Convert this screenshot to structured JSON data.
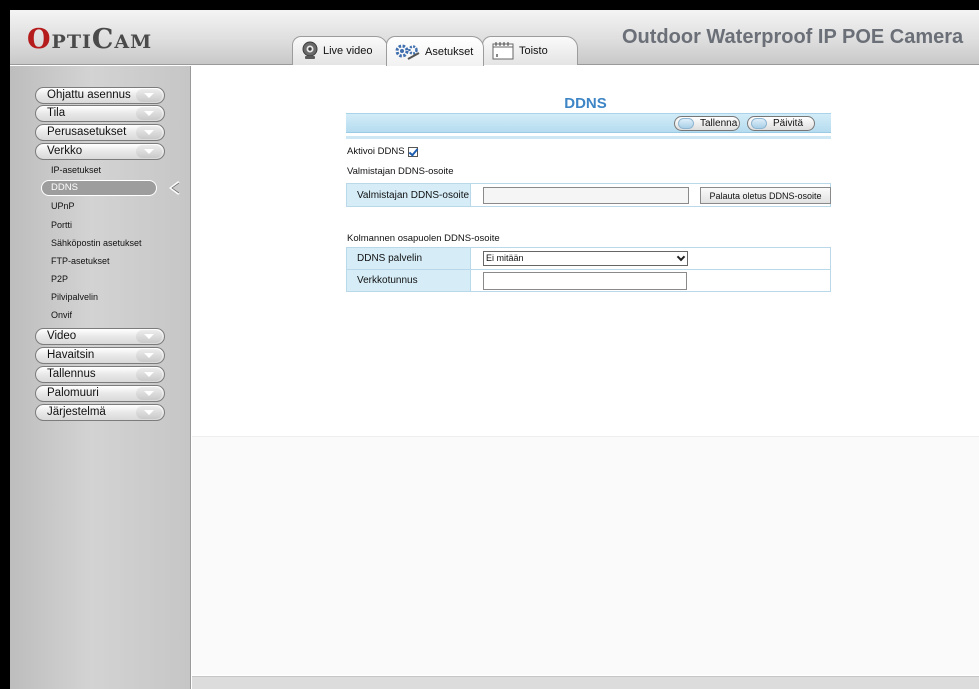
{
  "header": {
    "logo_first": "O",
    "logo_rest_1": "PTI",
    "logo_mid": "C",
    "logo_rest_2": "AM",
    "product_title": "Outdoor Waterproof IP POE Camera",
    "tabs": [
      {
        "label": "Live video",
        "icon": "webcam-icon"
      },
      {
        "label": "Asetukset",
        "icon": "gears-icon"
      },
      {
        "label": "Toisto",
        "icon": "calendar-icon"
      }
    ],
    "active_tab": "Asetukset"
  },
  "sidebar": {
    "menu": [
      {
        "label": "Ohjattu asennus"
      },
      {
        "label": "Tila"
      },
      {
        "label": "Perusasetukset"
      },
      {
        "label": "Verkko"
      }
    ],
    "network_sub": [
      {
        "label": "IP-asetukset"
      },
      {
        "label": "DDNS"
      },
      {
        "label": "UPnP"
      },
      {
        "label": "Portti"
      },
      {
        "label": "Sähköpostin asetukset"
      },
      {
        "label": "FTP-asetukset"
      },
      {
        "label": "P2P"
      },
      {
        "label": "Pilvipalvelin"
      },
      {
        "label": "Onvif"
      }
    ],
    "menu_after": [
      {
        "label": "Video"
      },
      {
        "label": "Havaitsin"
      },
      {
        "label": "Tallennus"
      },
      {
        "label": "Palomuuri"
      },
      {
        "label": "Järjestelmä"
      }
    ],
    "selected": "DDNS"
  },
  "main": {
    "title": "DDNS",
    "save_label": "Tallenna",
    "refresh_label": "Päivitä",
    "enable_label": "Aktivoi DDNS",
    "enable_checked": true,
    "manufacturer_section": "Valmistajan DDNS-osoite",
    "manufacturer_field_label": "Valmistajan DDNS-osoite",
    "manufacturer_field_value": "",
    "restore_button_label": "Palauta oletus DDNS-osoite",
    "third_party_section": "Kolmannen osapuolen DDNS-osoite",
    "ddns_server_label": "DDNS palvelin",
    "ddns_server_value": "Ei mitään",
    "username_label": "Verkkotunnus",
    "username_value": ""
  },
  "colors": {
    "accent": "#3d85c6",
    "logo_red": "#b51c1c",
    "row_label_bg": "#d6edf8"
  }
}
